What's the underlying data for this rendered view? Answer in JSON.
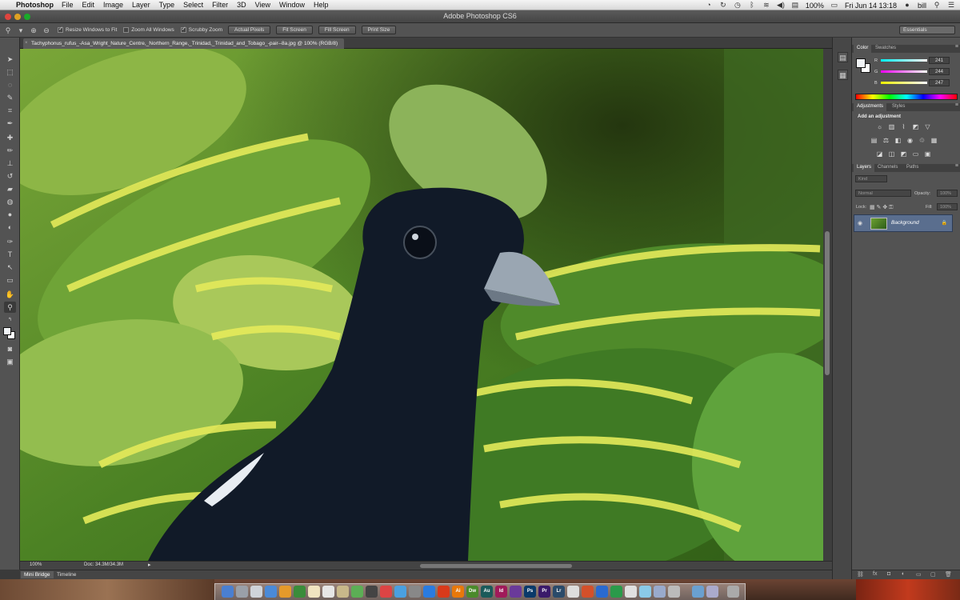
{
  "menubar": {
    "app": "Photoshop",
    "items": [
      "File",
      "Edit",
      "Image",
      "Layer",
      "Type",
      "Select",
      "Filter",
      "3D",
      "View",
      "Window",
      "Help"
    ],
    "battery": "100%",
    "datetime": "Fri Jun 14  13:18",
    "user": "bill"
  },
  "window": {
    "title": "Adobe Photoshop CS6"
  },
  "options": {
    "resize_windows": "Resize Windows to Fit",
    "zoom_all": "Zoom All Windows",
    "scrubby_zoom": "Scrubby Zoom",
    "actual_pixels": "Actual Pixels",
    "fit_screen": "Fit Screen",
    "fill_screen": "Fill Screen",
    "print_size": "Print Size",
    "workspace": "Essentials"
  },
  "document": {
    "tab_title": "Tachyphonus_rufus_-Asa_Wright_Nature_Centre,_Northern_Range,_Trinidad,_Trinidad_and_Tobago_-pair--8a.jpg @ 100% (RGB/8)"
  },
  "status": {
    "zoom": "100%",
    "doc": "Doc: 34.3M/34.3M"
  },
  "bottom_tabs": [
    "Mini Bridge",
    "Timeline"
  ],
  "color_panel": {
    "tabs": [
      "Color",
      "Swatches"
    ],
    "rows": [
      {
        "label": "R",
        "value": "241"
      },
      {
        "label": "G",
        "value": "244"
      },
      {
        "label": "B",
        "value": "247"
      }
    ],
    "fg_color": "#f1f4f7",
    "bg_color": "#ffffff"
  },
  "adjustments_panel": {
    "tabs": [
      "Adjustments",
      "Styles"
    ],
    "title": "Add an adjustment"
  },
  "layers_panel": {
    "tabs": [
      "Layers",
      "Channels",
      "Paths"
    ],
    "kind": "Kind",
    "blend_mode": "Normal",
    "opacity_label": "Opacity:",
    "opacity": "100%",
    "lock_label": "Lock:",
    "fill_label": "Fill:",
    "fill": "100%",
    "layer_name": "Background"
  },
  "dock": {
    "apps": [
      "Ai",
      "Dw",
      "Au",
      "Id",
      "Ps",
      "Pr",
      "Lr"
    ]
  }
}
